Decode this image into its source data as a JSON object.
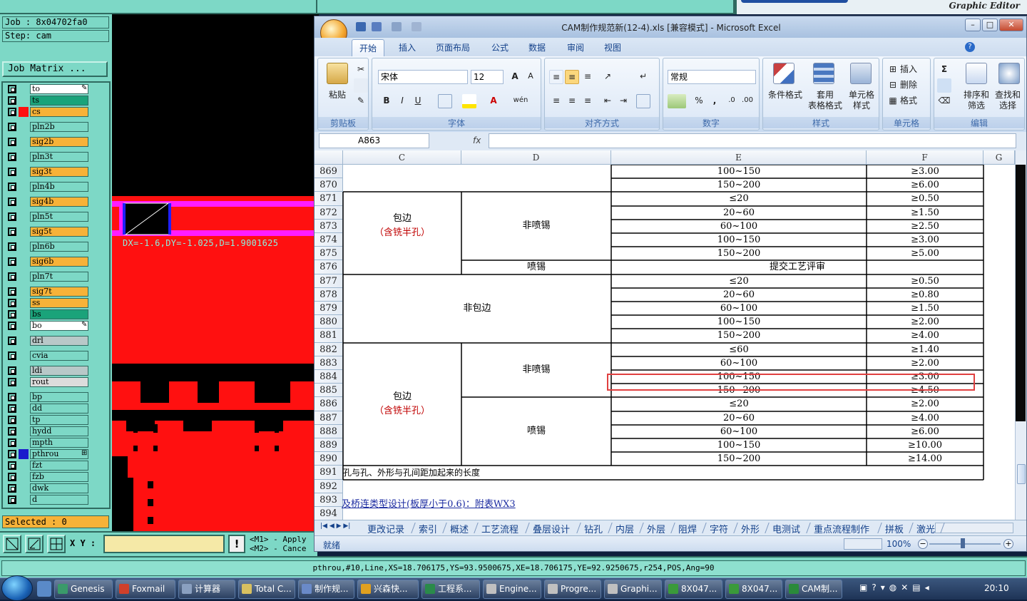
{
  "genesis": {
    "title": "Graphic Editor",
    "job_label": "Job : 8x04702fa0",
    "step_label": "Step: cam",
    "job_matrix_button": "Job Matrix ...",
    "layers": [
      {
        "name": "to",
        "color": "#ffffff",
        "flag": "✎"
      },
      {
        "name": "ts",
        "color": "#1aa37a",
        "flag": ""
      },
      {
        "name": "cs",
        "color": "#f7b238",
        "flag": ""
      },
      {
        "name": "pln2b",
        "color": "#7dd8c6",
        "flag": ""
      },
      {
        "name": "sig2b",
        "color": "#f7b238",
        "flag": ""
      },
      {
        "name": "pln3t",
        "color": "#7dd8c6",
        "flag": ""
      },
      {
        "name": "sig3t",
        "color": "#f7b238",
        "flag": ""
      },
      {
        "name": "pln4b",
        "color": "#7dd8c6",
        "flag": ""
      },
      {
        "name": "sig4b",
        "color": "#f7b238",
        "flag": ""
      },
      {
        "name": "pln5t",
        "color": "#7dd8c6",
        "flag": ""
      },
      {
        "name": "sig5t",
        "color": "#f7b238",
        "flag": ""
      },
      {
        "name": "pln6b",
        "color": "#7dd8c6",
        "flag": ""
      },
      {
        "name": "sig6b",
        "color": "#f7b238",
        "flag": ""
      },
      {
        "name": "pln7t",
        "color": "#7dd8c6",
        "flag": ""
      },
      {
        "name": "sig7t",
        "color": "#f7b238",
        "flag": ""
      },
      {
        "name": "ss",
        "color": "#f7b238",
        "flag": ""
      },
      {
        "name": "bs",
        "color": "#1aa37a",
        "flag": ""
      },
      {
        "name": "bo",
        "color": "#ffffff",
        "flag": "✎"
      },
      {
        "name": "drl",
        "color": "#b8c8c8",
        "flag": ""
      },
      {
        "name": "cvia",
        "color": "#7dd8c6",
        "flag": ""
      },
      {
        "name": "ldi",
        "color": "#b8c8c8",
        "flag": ""
      },
      {
        "name": "rout",
        "color": "#dcdcdc",
        "flag": ""
      },
      {
        "name": "bp",
        "color": "#7dd8c6",
        "flag": ""
      },
      {
        "name": "dd",
        "color": "#7dd8c6",
        "flag": ""
      },
      {
        "name": "tp",
        "color": "#7dd8c6",
        "flag": ""
      },
      {
        "name": "hydd",
        "color": "#7dd8c6",
        "flag": ""
      },
      {
        "name": "mpth",
        "color": "#7dd8c6",
        "flag": ""
      },
      {
        "name": "pthrou",
        "color": "#7dd8c6",
        "flag": "⊞"
      },
      {
        "name": "fzt",
        "color": "#7dd8c6",
        "flag": ""
      },
      {
        "name": "fzb",
        "color": "#7dd8c6",
        "flag": ""
      },
      {
        "name": "dwk",
        "color": "#7dd8c6",
        "flag": ""
      },
      {
        "name": "d",
        "color": "#7dd8c6",
        "flag": ""
      }
    ],
    "measure_readout": "DX=-1.6,DY=-1.025,D=1.9001625",
    "selected_label": "Selected : 0",
    "xy_label": "X Y :",
    "xy_value": "",
    "excl_label": "!",
    "mouse_hint": "<M1> - Apply\n<M2> - Cance",
    "status_line": "pthrou,#10,Line,XS=18.706175,YS=93.9500675,XE=18.706175,YE=92.9250675,r254,POS,Ang=90"
  },
  "excel": {
    "title": "CAM制作规范新(12-4).xls  [兼容模式]  -  Microsoft Excel",
    "tabs": [
      "开始",
      "插入",
      "页面布局",
      "公式",
      "数据",
      "审阅",
      "视图"
    ],
    "groups": {
      "clipboard": {
        "label": "剪贴板",
        "paste": "粘贴"
      },
      "font": {
        "label": "字体",
        "name": "宋体",
        "size": "12",
        "bold": "B",
        "italic": "I",
        "underline": "U",
        "grow": "A",
        "shrink": "A",
        "color_a": "A",
        "wen": "wén"
      },
      "align": {
        "label": "对齐方式"
      },
      "number": {
        "label": "数字",
        "format": "常规",
        "percent": "%",
        "comma": ","
      },
      "styles": {
        "label": "样式",
        "conditional": "条件格式",
        "table": "套用\n表格格式",
        "cell_style": "单元格\n样式"
      },
      "cells": {
        "label": "单元格",
        "insert": "插入",
        "delete": "删除",
        "format": "格式"
      },
      "edit": {
        "label": "编辑",
        "sort": "排序和\n筛选",
        "find": "查找和\n选择",
        "sum": "Σ"
      }
    },
    "name_box": "A863",
    "fx_label": "fx",
    "formula": "",
    "columns": [
      "C",
      "D",
      "E",
      "F",
      "G"
    ],
    "rows": [
      "869",
      "870",
      "871",
      "872",
      "873",
      "874",
      "875",
      "876",
      "877",
      "878",
      "879",
      "880",
      "881",
      "882",
      "883",
      "884",
      "885",
      "886",
      "887",
      "888",
      "889",
      "890",
      "891",
      "892",
      "893",
      "894"
    ],
    "cells": {
      "r869_ef": "100~150",
      "r869_g": "≥3.00",
      "r870_ef": "150~200",
      "r870_g": "≥6.00",
      "r871_ef": "≤20",
      "r871_g": "≥0.50",
      "r872_ef": "20~60",
      "r872_g": "≥1.50",
      "r873_ef": "60~100",
      "r873_g": "≥2.50",
      "r874_ef": "100~150",
      "r874_g": "≥3.00",
      "r875_ef": "150~200",
      "r875_g": "≥5.00",
      "r876_d": "喷锡",
      "r876_efg": "提交工艺评审",
      "r877_ef": "≤20",
      "r877_g": "≥0.50",
      "r878_ef": "20~60",
      "r878_g": "≥0.80",
      "r879_ef": "60~100",
      "r879_g": "≥1.50",
      "r880_ef": "100~150",
      "r880_g": "≥2.00",
      "r881_ef": "150~200",
      "r881_g": "≥4.00",
      "r882_ef": "≤60",
      "r882_g": "≥1.40",
      "r883_ef": "60~100",
      "r883_g": "≥2.00",
      "r884_ef": "100~150",
      "r884_g": "≥3.00",
      "r885_ef": "150~200",
      "r885_g": "≥4.50",
      "r886_ef": "≤20",
      "r886_g": "≥2.00",
      "r887_ef": "20~60",
      "r887_g": "≥4.00",
      "r888_ef": "60~100",
      "r888_g": "≥6.00",
      "r889_ef": "100~150",
      "r889_g": "≥10.00",
      "r890_ef": "150~200",
      "r890_g": "≥14.00",
      "block1_c1": "包边",
      "block1_c2": "（含铣半孔）",
      "block1_d": "非喷锡",
      "block2_cd": "非包边",
      "block3_c1": "包边",
      "block3_c2": "（含铣半孔）",
      "block3_d1": "非喷锡",
      "block3_d2": "喷锡",
      "r891": "孔与孔、外形与孔间距加起来的长度",
      "r893": "及桥连类型设计(板厚小于0.6)：附表WX3"
    },
    "sheet_tabs": [
      "更改记录",
      "索引",
      "概述",
      "工艺流程",
      "叠层设计",
      "钻孔",
      "内层",
      "外层",
      "阻焊",
      "字符",
      "外形",
      "电测试",
      "重点流程制作",
      "拼板",
      "激光"
    ],
    "status_ready": "就绪",
    "zoom": "100%"
  },
  "taskbar": {
    "items": [
      {
        "label": "Genesis",
        "color": "#3a9a6a"
      },
      {
        "label": "Foxmail",
        "color": "#d0402a"
      },
      {
        "label": "计算器",
        "color": "#8aa0c0"
      },
      {
        "label": "Total C...",
        "color": "#d8c060"
      },
      {
        "label": "制作规...",
        "color": "#6a8ac8"
      },
      {
        "label": "兴森快...",
        "color": "#e0a020"
      },
      {
        "label": "工程系...",
        "color": "#2a8a4a"
      },
      {
        "label": "Engine...",
        "color": "#c0c0c0"
      },
      {
        "label": "Progre...",
        "color": "#c0c0c0"
      },
      {
        "label": "Graphi...",
        "color": "#c0c0c0"
      },
      {
        "label": "8X047...",
        "color": "#3a9a3a"
      },
      {
        "label": "8X047...",
        "color": "#3a9a3a"
      },
      {
        "label": "CAM制...",
        "color": "#2a8a3a"
      }
    ],
    "clock": "20:10"
  }
}
